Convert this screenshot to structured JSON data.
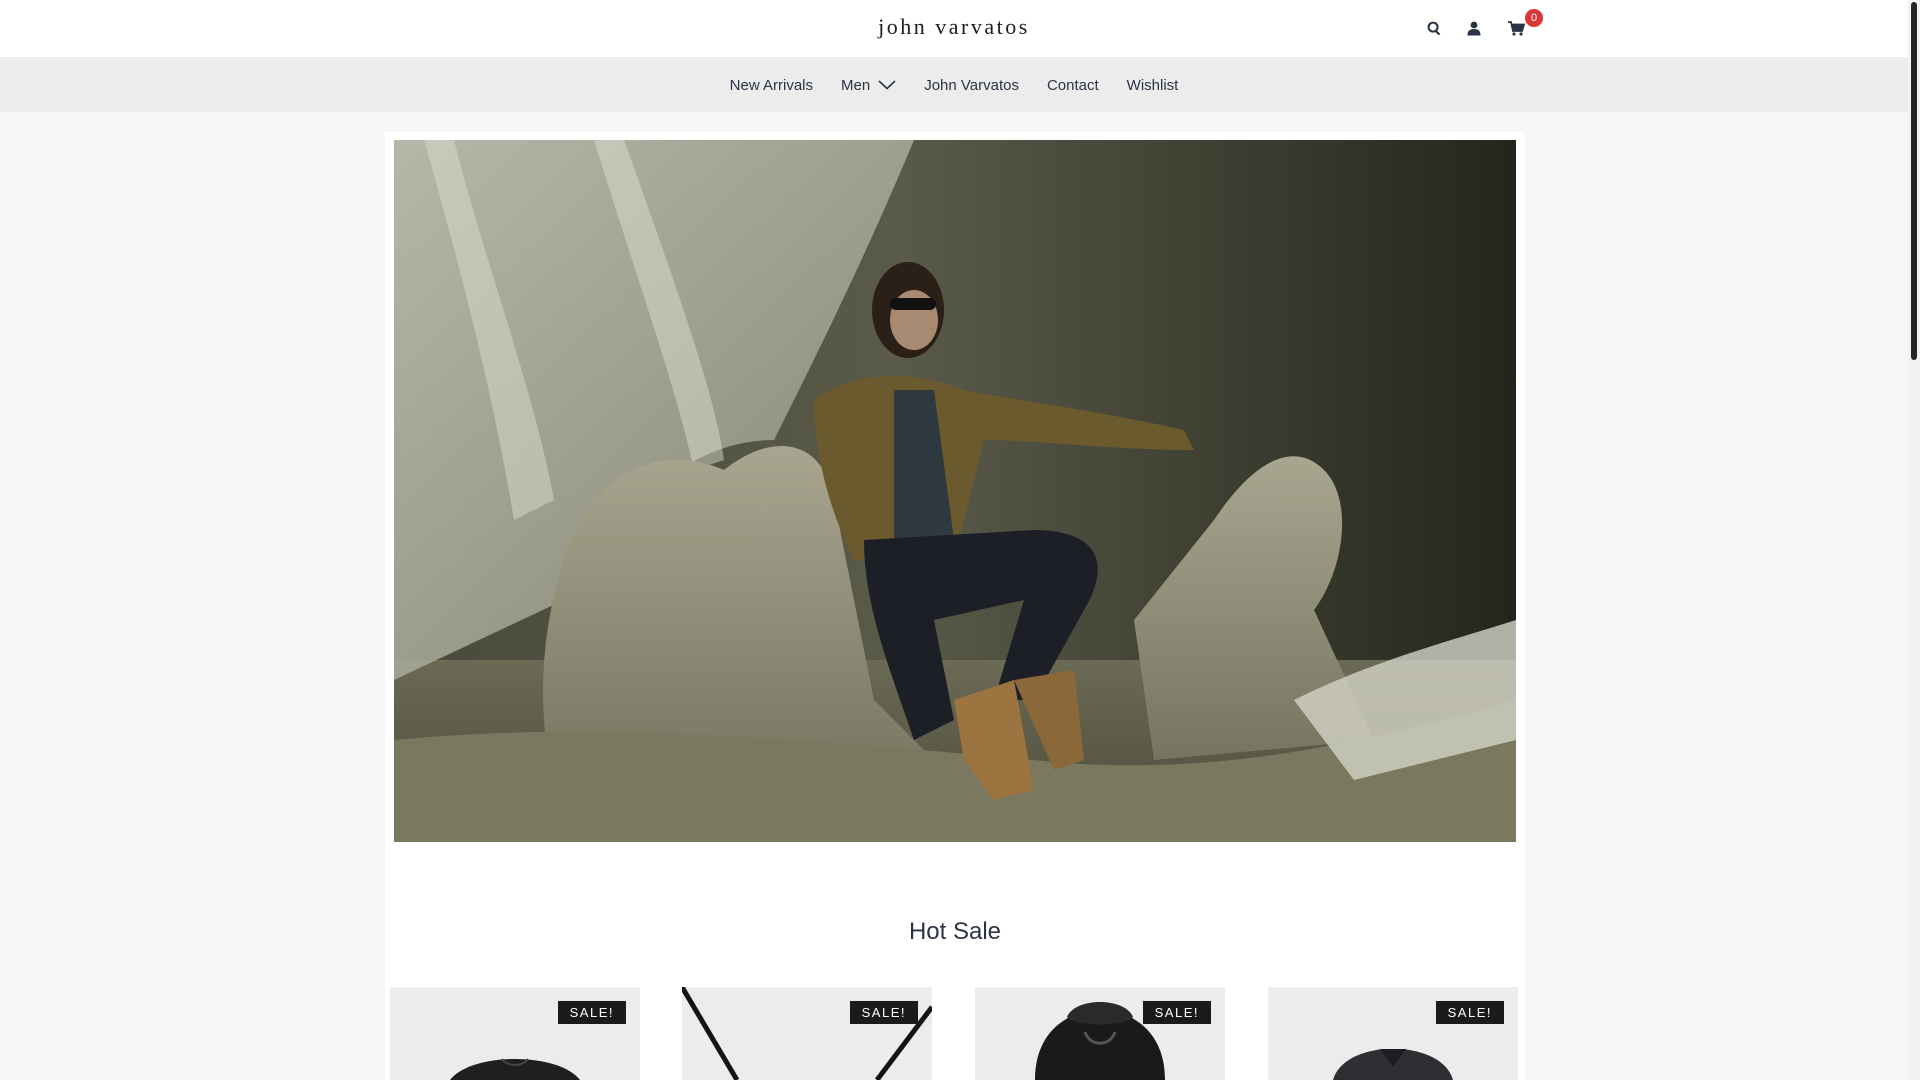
{
  "header": {
    "logo": "john varvatos",
    "cart_count": "0",
    "icons": [
      "search-icon",
      "user-icon",
      "cart-icon"
    ]
  },
  "nav": {
    "items": [
      {
        "label": "New Arrivals"
      },
      {
        "label": "Men",
        "has_dropdown": true
      },
      {
        "label": "John Varvatos"
      },
      {
        "label": "Contact"
      },
      {
        "label": "Wishlist"
      }
    ]
  },
  "hero": {
    "image": "model-seated-on-draped-chair"
  },
  "hot_sale": {
    "title": "Hot Sale",
    "products": [
      {
        "badge": "SALE!",
        "image": "black-sweater"
      },
      {
        "badge": "SALE!",
        "image": "black-strap-bag"
      },
      {
        "badge": "SALE!",
        "image": "shearling-jacket"
      },
      {
        "badge": "SALE!",
        "image": "grey-coat"
      }
    ]
  },
  "colors": {
    "text": "#2b3346",
    "badge_bg": "#1b1b1b",
    "cart_count_bg": "#d9383a",
    "nav_bg": "#ececec"
  }
}
